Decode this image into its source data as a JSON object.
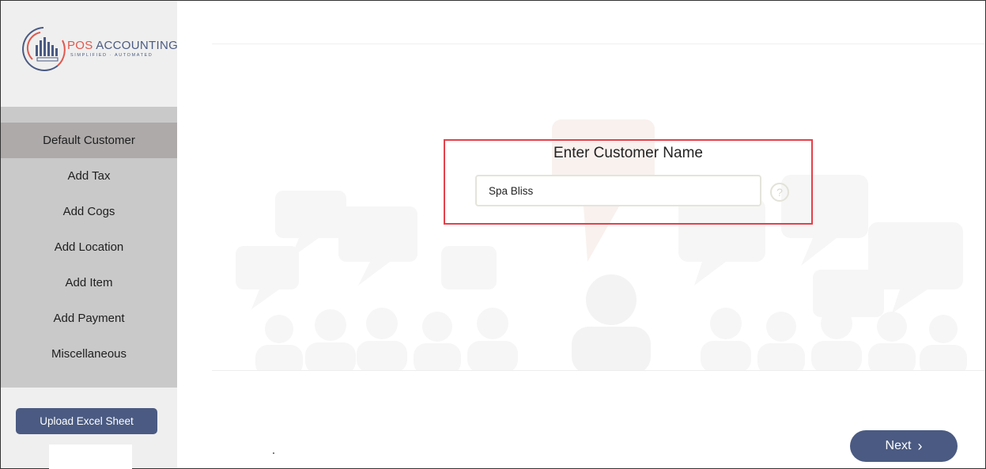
{
  "brand": {
    "title_part1": "POS",
    "title_part2": " ACCOUNTING",
    "tagline": "SIMPLIFIED · AUTOMATED",
    "colors": {
      "accent_red": "#e0584e",
      "navy": "#4a5a82"
    }
  },
  "sidebar": {
    "items": [
      {
        "label": "Default Customer",
        "active": true
      },
      {
        "label": "Add Tax",
        "active": false
      },
      {
        "label": "Add Cogs",
        "active": false
      },
      {
        "label": "Add Location",
        "active": false
      },
      {
        "label": "Add Item",
        "active": false
      },
      {
        "label": "Add Payment",
        "active": false
      },
      {
        "label": "Miscellaneous",
        "active": false
      }
    ],
    "upload_button": "Upload Excel Sheet"
  },
  "main": {
    "field_label": "Enter Customer Name",
    "customer_input_value": "Spa Bliss",
    "help_icon_glyph": "?",
    "next_button": "Next",
    "next_icon": "chevron-right-icon"
  },
  "colors": {
    "highlight_border": "#e5404a",
    "nav_background": "#c9c9c9",
    "nav_active": "#aeaaaa",
    "button": "#4a5a82"
  }
}
